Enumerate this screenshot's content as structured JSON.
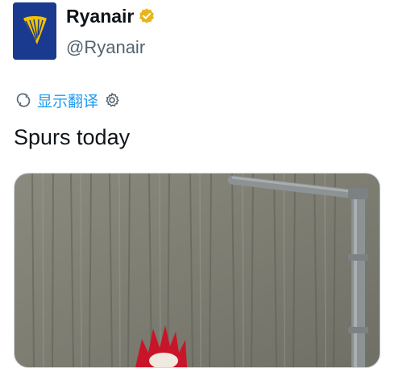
{
  "account": {
    "display_name": "Ryanair",
    "handle": "@Ryanair",
    "verified_icon": "gold-verified-badge",
    "avatar_icon": "ryanair-harp-logo"
  },
  "translate": {
    "label": "显示翻译",
    "icon": "translate-icon",
    "settings_icon": "gear-icon"
  },
  "tweet": {
    "text": "Spurs today"
  },
  "media": {
    "description_icon": "photo"
  },
  "colors": {
    "accent": "#1d9bf0",
    "avatar_bg": "#1a3a8f",
    "logo_gold": "#f2c200"
  }
}
